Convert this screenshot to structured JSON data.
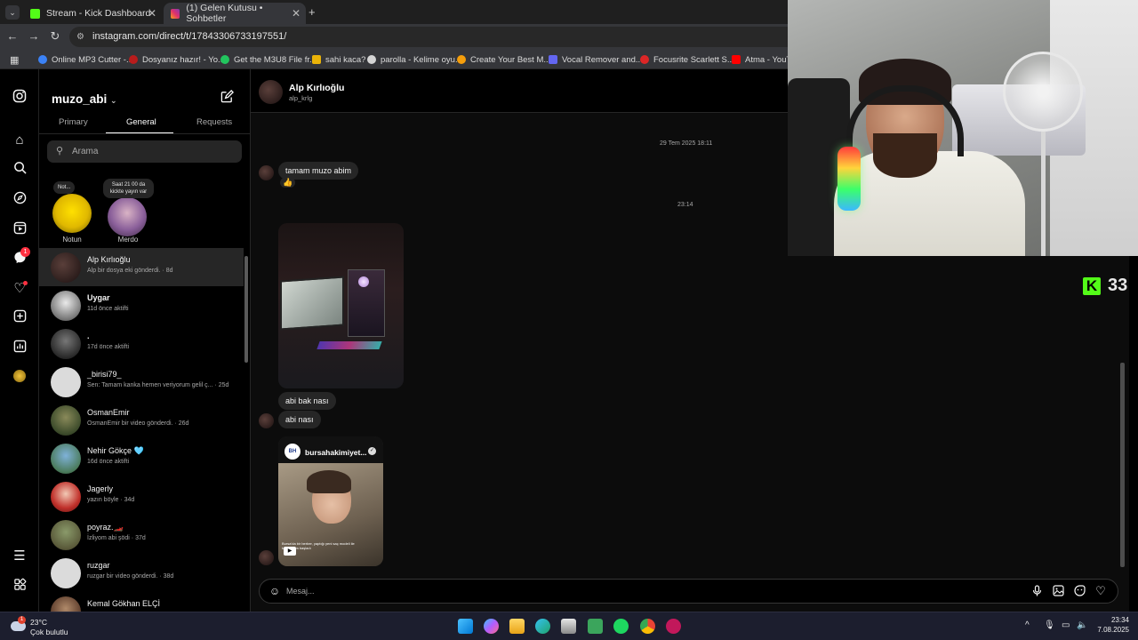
{
  "browser": {
    "tabs": [
      {
        "title": "Stream - Kick Dashboard",
        "active": false
      },
      {
        "title": "(1) Gelen Kutusu • Sohbetler",
        "active": true
      }
    ],
    "new_tab": "+",
    "url": "instagram.com/direct/t/17843306733197551/",
    "bookmarks": [
      "Online MP3 Cutter -...",
      "Dosyanız hazır! - Yo...",
      "Get the M3U8 File fr...",
      "sahi kaca?",
      "parolla - Kelime oyu...",
      "Create Your Best M...",
      "Vocal Remover and...",
      "Focusrite Scarlett S...",
      "Atma - YouTu"
    ]
  },
  "sidebar": {
    "username": "muzo_abi",
    "tabs": [
      "Primary",
      "General",
      "Requests"
    ],
    "search_placeholder": "Arama",
    "notes": [
      {
        "bubble": "Not...",
        "name": "Notun"
      },
      {
        "bubble": "Saat 21 00 da kickte yayın var",
        "name": "Merdo"
      }
    ],
    "conversations": [
      {
        "name": "Alp Kırlıoğlu",
        "sub": "Alp bir dosya eki gönderdi. · 8d",
        "selected": true
      },
      {
        "name": "Uygar",
        "sub": "11d önce aktifti"
      },
      {
        "name": ".",
        "sub": "17d önce aktifti"
      },
      {
        "name": "_birisi79_",
        "sub": "Sen: Tamam kanka hemen veriyorum gelil ç... · 25d"
      },
      {
        "name": "OsmanEmir",
        "sub": "OsmanEmir bir video gönderdi. · 26d"
      },
      {
        "name": "Nehir Gökçe 🩵",
        "sub": "16d önce aktifti"
      },
      {
        "name": "Jagerly",
        "sub": "yazın böyle · 34d"
      },
      {
        "name": "poyraz.🏎️",
        "sub": "İzliyom abi şödi · 37d"
      },
      {
        "name": "ruzgar",
        "sub": "ruzgar bir video gönderdi. · 38d"
      },
      {
        "name": "Kemal Gökhan ELÇİ",
        "sub": ""
      }
    ],
    "notification_badge": "1"
  },
  "chat": {
    "name": "Alp Kırlıoğlu",
    "handle": "alp_krlg",
    "timestamp1": "29 Tem 2025 18:11",
    "msg1": "tamam muzo abim",
    "reaction": "👍",
    "timestamp2": "23:14",
    "msg2": "abi bak nası",
    "msg3": "abi nası",
    "reel_account": "bursahakimiyet...",
    "reel_caption": "Bursa'da bir berber, yaptığı yeni saç modeli ile tanınmaya başladı",
    "composer_placeholder": "Mesaj..."
  },
  "overlay": {
    "kick_logo": "K",
    "viewer_count": "33"
  },
  "taskbar": {
    "weather_temp": "23°C",
    "weather_cond": "Çok bulutlu",
    "weather_badge": "1",
    "time": "23:34",
    "date": "7.08.2025"
  },
  "colors": {
    "instagram_bg": "#000000",
    "bubble": "#262626",
    "kick_green": "#53fc18",
    "taskbar": "#1c1e2e"
  }
}
